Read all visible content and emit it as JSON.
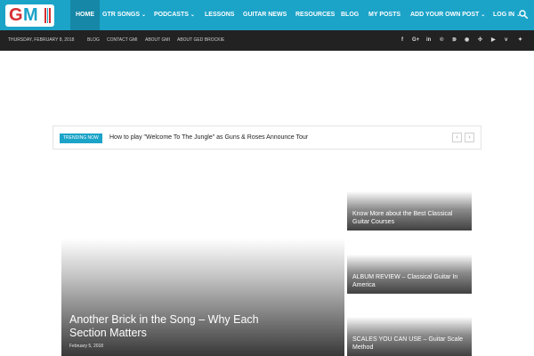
{
  "logo": {
    "letters": [
      "G",
      "M"
    ]
  },
  "nav": {
    "items": [
      {
        "label": "Home",
        "has_dropdown": false,
        "active": true
      },
      {
        "label": "GTR Songs",
        "has_dropdown": true,
        "active": false
      },
      {
        "label": "Podcasts",
        "has_dropdown": true,
        "active": false
      },
      {
        "label": "Lessons",
        "has_dropdown": false,
        "active": false
      },
      {
        "label": "Guitar News",
        "has_dropdown": false,
        "active": false
      },
      {
        "label": "Resources",
        "has_dropdown": false,
        "active": false
      },
      {
        "label": "Blog",
        "has_dropdown": false,
        "active": false
      },
      {
        "label": "My Posts",
        "has_dropdown": false,
        "active": false
      },
      {
        "label": "Add Your Own Post",
        "has_dropdown": true,
        "active": false
      },
      {
        "label": "Log In",
        "has_dropdown": true,
        "active": false
      }
    ],
    "chevron": "⌄",
    "search_icon": "search-icon"
  },
  "subbar": {
    "date": "Thursday, February 8, 2018",
    "links": [
      "Blog",
      "Contact GMI",
      "About GMI",
      "About Ged Brockie"
    ],
    "social": [
      {
        "name": "facebook-icon",
        "glyph": "f"
      },
      {
        "name": "google-plus-icon",
        "glyph": "G+"
      },
      {
        "name": "linkedin-icon",
        "glyph": "in"
      },
      {
        "name": "pinterest-icon",
        "glyph": "℗"
      },
      {
        "name": "rss-icon",
        "glyph": "⋑"
      },
      {
        "name": "reddit-icon",
        "glyph": "◉"
      },
      {
        "name": "stumbleupon-icon",
        "glyph": "✣"
      },
      {
        "name": "youtube-icon",
        "glyph": "▶"
      },
      {
        "name": "vimeo-icon",
        "glyph": "v"
      },
      {
        "name": "twitter-icon",
        "glyph": "✦"
      }
    ]
  },
  "trending": {
    "badge": "Trending Now",
    "headline": "How to play \"Welcome To The Jungle\" as Guns & Roses Announce Tour",
    "prev": "‹",
    "next": "›"
  },
  "featured": {
    "main": {
      "title": "Another Brick in the Song – Why Each Section Matters",
      "date": "February 5, 2018"
    },
    "side": [
      {
        "title": "Know More about the Best Classical Guitar Courses"
      },
      {
        "title": "ALBUM REVIEW – Classical Guitar In America"
      },
      {
        "title": "SCALES YOU CAN USE – Guitar Scale Method"
      }
    ]
  },
  "colors": {
    "brand": "#1ba3c8",
    "brand_dark": "#1687a6",
    "subbar": "#222222",
    "logo_red": "#d62f31"
  }
}
